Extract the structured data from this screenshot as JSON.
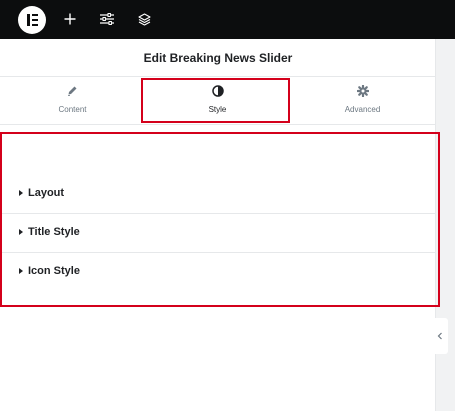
{
  "topbar": {
    "logo_icon": "elementor-logo-icon",
    "add_icon": "plus-icon",
    "settings_icon": "sliders-icon",
    "structure_icon": "layers-icon",
    "background": "#0c0d0e"
  },
  "panel": {
    "title": "Edit Breaking News Slider",
    "tabs": [
      {
        "label": "Content",
        "icon": "pencil-icon",
        "active": false
      },
      {
        "label": "Style",
        "icon": "half-circle-icon",
        "active": true
      },
      {
        "label": "Advanced",
        "icon": "gear-icon",
        "active": false
      }
    ],
    "sections": [
      {
        "label": "Layout"
      },
      {
        "label": "Title Style"
      },
      {
        "label": "Icon Style"
      }
    ],
    "collapse_icon": "chevron-left-icon"
  },
  "colors": {
    "highlight": "#d4001b",
    "text": "#1f2124",
    "muted_text": "#6d7882",
    "divider": "#e6e8ea"
  }
}
